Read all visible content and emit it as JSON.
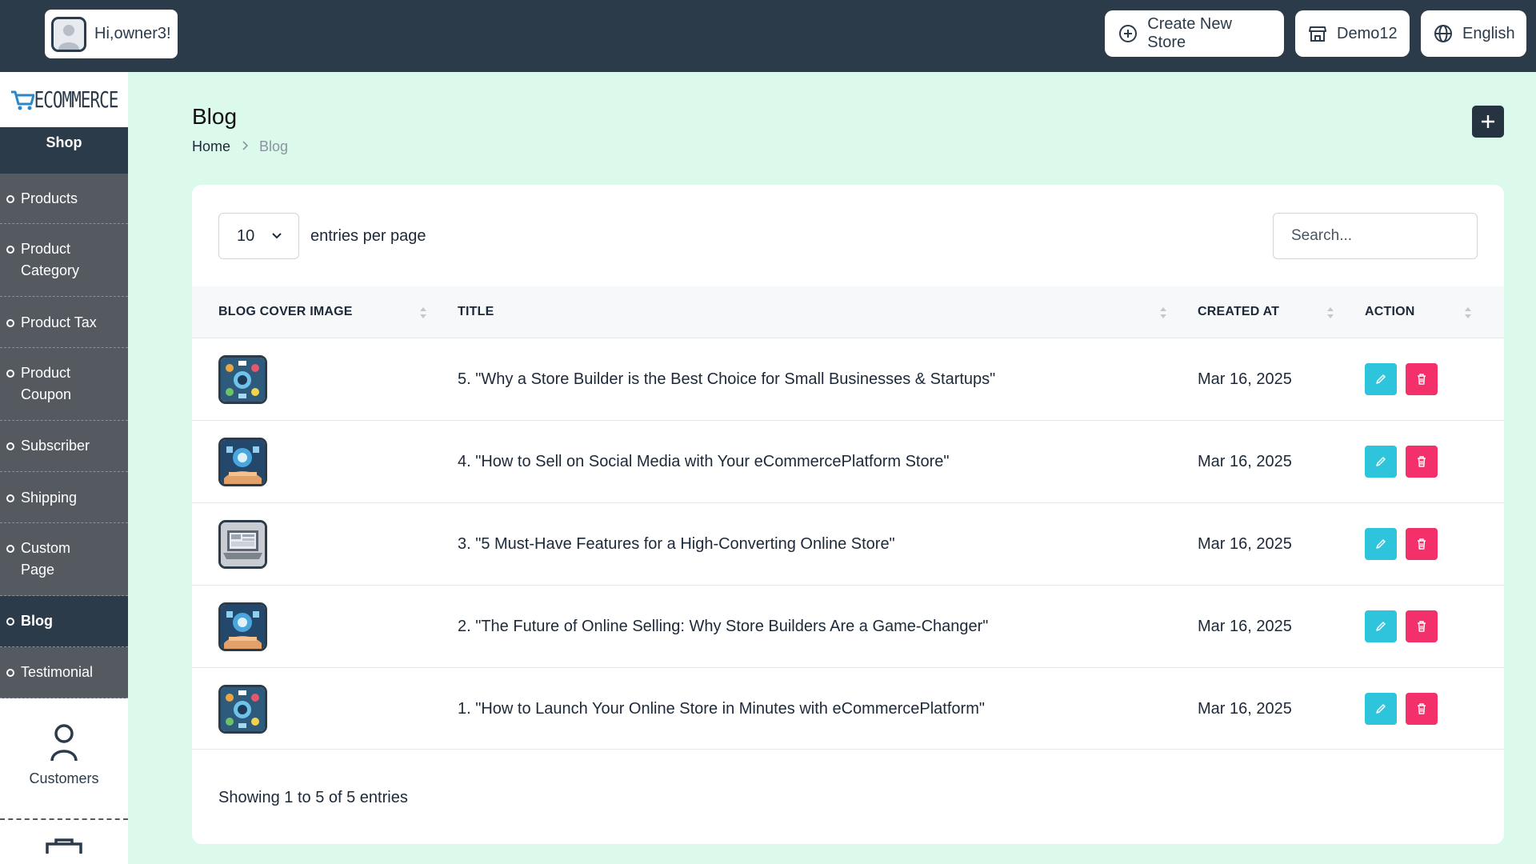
{
  "topbar": {
    "greeting": "Hi,owner3!",
    "create_store_label": "Create New Store",
    "store_label": "Demo12",
    "language_label": "English"
  },
  "sidebar": {
    "logo_text": "ECOMMERCE",
    "section_title": "Shop",
    "items": [
      {
        "label": "Products"
      },
      {
        "label": "Product Category"
      },
      {
        "label": "Product Tax"
      },
      {
        "label": "Product Coupon"
      },
      {
        "label": "Subscriber"
      },
      {
        "label": "Shipping"
      },
      {
        "label": "Custom Page"
      },
      {
        "label": "Blog",
        "active": true
      },
      {
        "label": "Testimonial"
      }
    ],
    "customers_label": "Customers"
  },
  "page": {
    "title": "Blog",
    "breadcrumb": {
      "home": "Home",
      "current": "Blog"
    }
  },
  "table": {
    "entries_value": "10",
    "entries_label": "entries per page",
    "search_placeholder": "Search...",
    "columns": [
      "BLOG COVER IMAGE",
      "TITLE",
      "CREATED AT",
      "ACTION"
    ],
    "rows": [
      {
        "title": "5. \"Why a Store Builder is the Best Choice for Small Businesses & Startups\"",
        "created_at": "Mar 16, 2025",
        "thumb": "hub"
      },
      {
        "title": "4. \"How to Sell on Social Media with Your eCommercePlatform Store\"",
        "created_at": "Mar 16, 2025",
        "thumb": "hand"
      },
      {
        "title": "3. \"5 Must-Have Features for a High-Converting Online Store\"",
        "created_at": "Mar 16, 2025",
        "thumb": "laptop"
      },
      {
        "title": "2. \"The Future of Online Selling: Why Store Builders Are a Game-Changer\"",
        "created_at": "Mar 16, 2025",
        "thumb": "hand"
      },
      {
        "title": "1. \"How to Launch Your Online Store in Minutes with eCommercePlatform\"",
        "created_at": "Mar 16, 2025",
        "thumb": "hub"
      }
    ],
    "footer": "Showing 1 to 5 of 5 entries"
  },
  "colors": {
    "topbar": "#2b3b4a",
    "page_bg": "#dcfaeb",
    "edit": "#2ec4dc",
    "delete": "#f4306a",
    "sidebar_menu": "#555a61"
  },
  "icons": {
    "create": "plus-circle-icon",
    "store": "store-icon",
    "language": "globe-icon",
    "edit": "pencil-icon",
    "delete": "trash-icon",
    "sort": "sort-icon"
  }
}
